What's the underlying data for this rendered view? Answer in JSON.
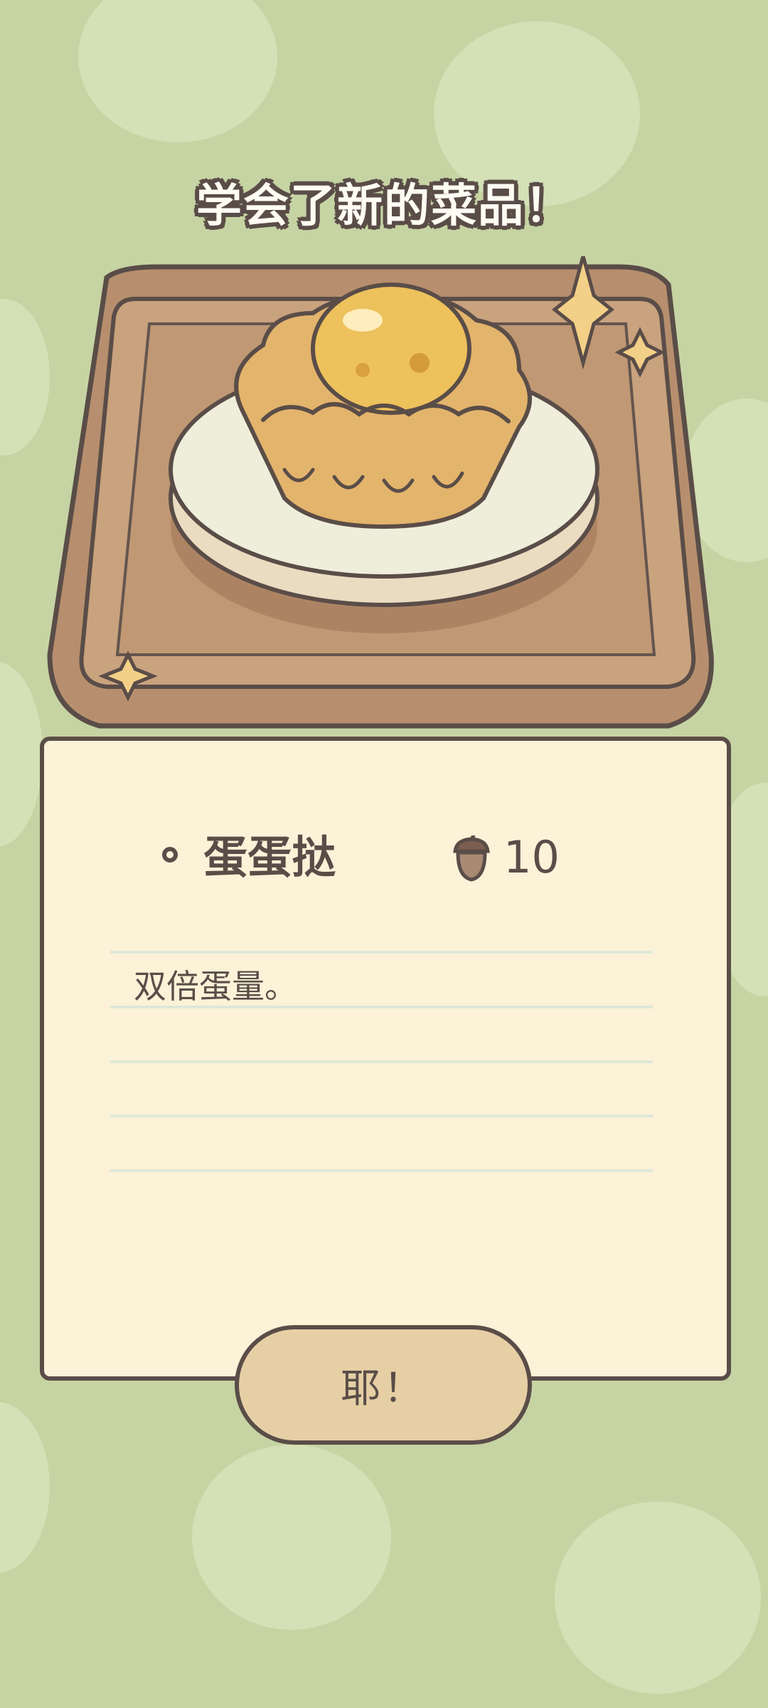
{
  "header": {
    "title": "学会了新的菜品！"
  },
  "dish": {
    "image": "egg-tart-icon",
    "name": "蛋蛋挞",
    "price_icon": "acorn-icon",
    "price": "10",
    "description": "双倍蛋量。"
  },
  "actions": {
    "confirm_label": "耶！"
  },
  "colors": {
    "background": "#c6d4a3",
    "card": "#fbf2d8",
    "outline": "#5a4d48",
    "button": "#e6cfa5",
    "tray": "#b78f6e"
  }
}
